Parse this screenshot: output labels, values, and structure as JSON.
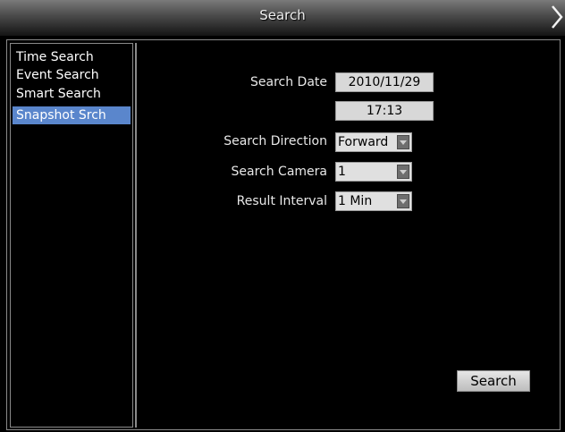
{
  "window": {
    "title": "Search",
    "close_icon": "chevron-right-icon"
  },
  "sidebar": {
    "items": [
      {
        "label": "Time Search",
        "selected": false
      },
      {
        "label": "Event Search",
        "selected": false
      },
      {
        "label": "Smart Search",
        "selected": false
      },
      {
        "label": "Snapshot Srch",
        "selected": true
      }
    ],
    "selected_color": "#5a86cc"
  },
  "form": {
    "search_date_label": "Search Date",
    "search_date_value": "2010/11/29",
    "search_time_value": "17:13",
    "direction_label": "Search Direction",
    "direction_value": "Forward",
    "camera_label": "Search Camera",
    "camera_value": "1",
    "interval_label": "Result Interval",
    "interval_value": "1 Min"
  },
  "actions": {
    "search_label": "Search"
  }
}
